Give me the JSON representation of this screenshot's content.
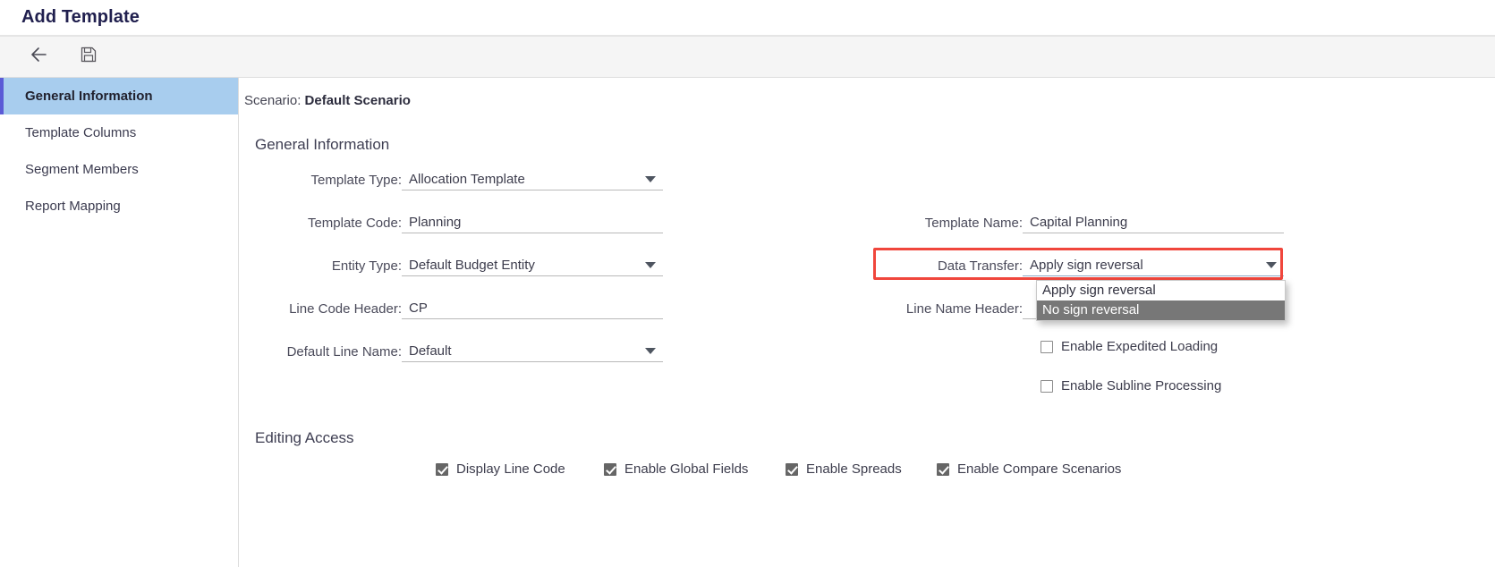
{
  "window": {
    "title": "Add Template"
  },
  "toolbar": {
    "back_icon": "arrow-left-icon",
    "save_icon": "save-disk-icon"
  },
  "sidebar": {
    "items": [
      {
        "label": "General Information",
        "active": true
      },
      {
        "label": "Template Columns",
        "active": false
      },
      {
        "label": "Segment Members",
        "active": false
      },
      {
        "label": "Report Mapping",
        "active": false
      }
    ]
  },
  "main": {
    "scenario_label": "Scenario:",
    "scenario_value": "Default Scenario",
    "sections": {
      "general": "General Information",
      "editing": "Editing Access"
    },
    "fields": {
      "template_type": {
        "label": "Template Type:",
        "value": "Allocation Template",
        "type": "select"
      },
      "template_code": {
        "label": "Template Code:",
        "value": "Planning",
        "type": "text"
      },
      "entity_type": {
        "label": "Entity Type:",
        "value": "Default Budget Entity",
        "type": "select"
      },
      "line_code_header": {
        "label": "Line Code Header:",
        "value": "CP",
        "type": "text"
      },
      "default_line_name": {
        "label": "Default Line Name:",
        "value": "Default",
        "type": "select"
      },
      "template_name": {
        "label": "Template Name:",
        "value": "Capital Planning",
        "type": "text"
      },
      "data_transfer": {
        "label": "Data Transfer:",
        "value": "Apply sign reversal",
        "type": "select",
        "highlighted": true
      },
      "line_name_header": {
        "label": "Line Name Header:",
        "value": "",
        "type": "text"
      }
    },
    "data_transfer_dropdown": {
      "open": true,
      "options": [
        {
          "label": "Apply sign reversal",
          "selected": false
        },
        {
          "label": "No sign reversal",
          "selected": true
        }
      ]
    },
    "option_checkboxes": [
      {
        "label": "Enable Expedited Loading",
        "checked": false
      },
      {
        "label": "Enable Subline Processing",
        "checked": false
      }
    ],
    "editing_access_checkboxes": [
      {
        "label": "Display Line Code",
        "checked": true
      },
      {
        "label": "Enable Global Fields",
        "checked": true
      },
      {
        "label": "Enable Spreads",
        "checked": true
      },
      {
        "label": "Enable Compare Scenarios",
        "checked": true
      }
    ]
  },
  "colors": {
    "title": "#201f4e",
    "sidebar_active_bg": "#a8cdee",
    "sidebar_active_accent": "#5b5bd6",
    "highlight_border": "#f0463c",
    "dropdown_selected_bg": "#777777"
  }
}
